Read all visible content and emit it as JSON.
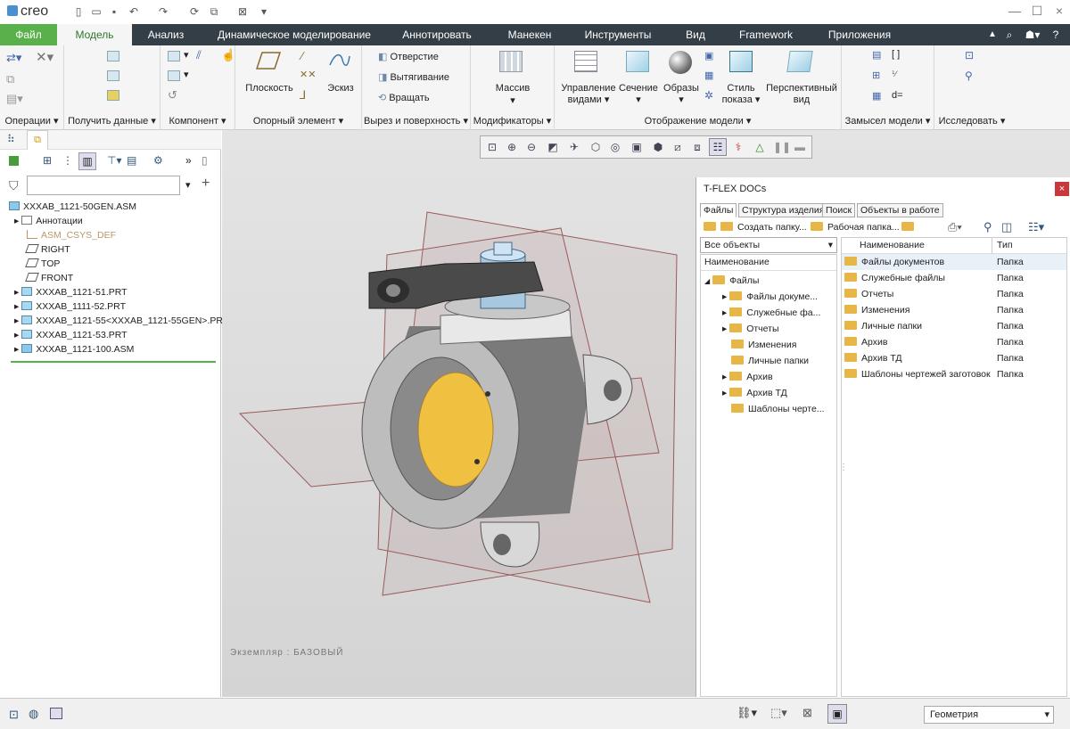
{
  "app": {
    "logo": "creo",
    "logo_dot": "·"
  },
  "tabs": [
    {
      "label": "Файл"
    },
    {
      "label": "Модель"
    },
    {
      "label": "Анализ"
    },
    {
      "label": "Динамическое моделирование"
    },
    {
      "label": "Аннотировать"
    },
    {
      "label": "Манекен"
    },
    {
      "label": "Инструменты"
    },
    {
      "label": "Вид"
    },
    {
      "label": "Framework"
    },
    {
      "label": "Приложения"
    }
  ],
  "ribbon": {
    "groups": {
      "operations": "Операции",
      "get_data": "Получить данные",
      "component": "Компонент",
      "datum": "Опорный элемент",
      "cut_surface": "Вырез и поверхность",
      "modifiers": "Модификаторы",
      "model_display": "Отображение модели",
      "design_intent": "Замысел модели",
      "investigate": "Исследовать"
    },
    "plane": "Плоскость",
    "sketch": "Эскиз",
    "hole": "Отверстие",
    "extrude": "Вытягивание",
    "revolve": "Вращать",
    "pattern": "Массив",
    "manage_views_1": "Управление",
    "manage_views_2": "видами",
    "section": "Сечение",
    "appearances": "Образы",
    "display_style_1": "Стиль",
    "display_style_2": "показа",
    "perspective_1": "Перспективный",
    "perspective_2": "вид",
    "d_eq": "d="
  },
  "model_tree": {
    "filter_placeholder": "",
    "items": [
      {
        "label": "XXXAB_1121-50GEN.ASM"
      },
      {
        "label": "Аннотации"
      },
      {
        "label": "ASM_CSYS_DEF"
      },
      {
        "label": "RIGHT"
      },
      {
        "label": "TOP"
      },
      {
        "label": "FRONT"
      },
      {
        "label": "XXXAB_1121-51.PRT"
      },
      {
        "label": "XXXAB_1111-52.PRT"
      },
      {
        "label": "XXXAB_1121-55<XXXAB_1121-55GEN>.PRT"
      },
      {
        "label": "XXXAB_1121-53.PRT"
      },
      {
        "label": "XXXAB_1121-100.ASM"
      }
    ]
  },
  "viewport": {
    "instance_label": "Экземпляр : БАЗОВЫЙ"
  },
  "tflex": {
    "title": "T-FLEX DOCs",
    "tabs": [
      {
        "label": "Файлы"
      },
      {
        "label": "Структура изделия"
      },
      {
        "label": "Поиск"
      },
      {
        "label": "Объекты в работе"
      }
    ],
    "create_folder": "Создать папку...",
    "working_folder": "Рабочая папка...",
    "filter_value": "Все объекты",
    "col_name": "Наименование",
    "col_type": "Тип",
    "tree_root": "Файлы",
    "tree": [
      {
        "label": "Файлы докуме...",
        "exp": "▸"
      },
      {
        "label": "Служебные фа...",
        "exp": "▸"
      },
      {
        "label": "Отчеты",
        "exp": "▸"
      },
      {
        "label": "Изменения",
        "exp": ""
      },
      {
        "label": "Личные папки",
        "exp": ""
      },
      {
        "label": "Архив",
        "exp": "▸"
      },
      {
        "label": "Архив ТД",
        "exp": "▸"
      },
      {
        "label": "Шаблоны черте...",
        "exp": ""
      }
    ],
    "list": [
      {
        "name": "Файлы документов",
        "type": "Папка"
      },
      {
        "name": "Служебные файлы",
        "type": "Папка"
      },
      {
        "name": "Отчеты",
        "type": "Папка"
      },
      {
        "name": "Изменения",
        "type": "Папка"
      },
      {
        "name": "Личные папки",
        "type": "Папка"
      },
      {
        "name": "Архив",
        "type": "Папка"
      },
      {
        "name": "Архив ТД",
        "type": "Папка"
      },
      {
        "name": "Шаблоны чертежей заготовок",
        "type": "Папка"
      }
    ]
  },
  "status": {
    "filter_value": "Геометрия"
  },
  "glyphs": {
    "dropdown": "▾",
    "expand": "▸",
    "collapse": "◢",
    "close": "×",
    "plus": "+",
    "more": "»",
    "min": "—",
    "max": "☐"
  },
  "colors": {
    "tab_bar": "#343e46",
    "file_tab": "#5ab04a",
    "model_active": "#2a7a2a",
    "folder": "#e8b547",
    "tflex_close": "#c8383a"
  }
}
